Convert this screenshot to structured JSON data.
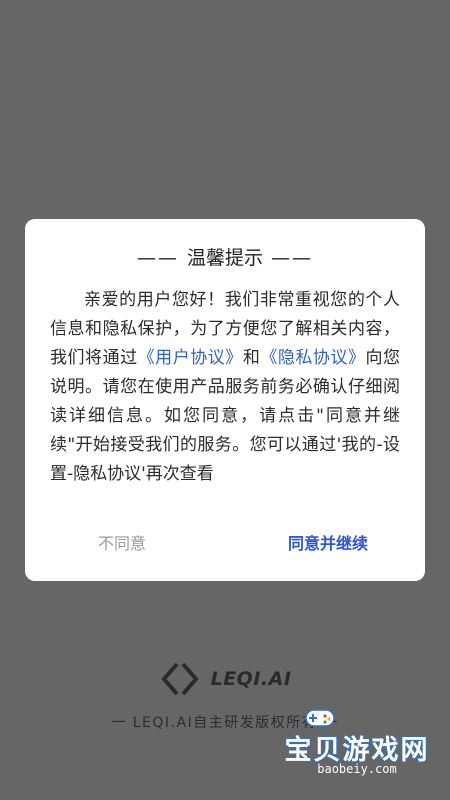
{
  "splash": {
    "brand_name": "LEQI.AI",
    "copyright": "一  LEQI.AI自主研发版权所有  一"
  },
  "watermark": {
    "title": "宝贝游戏网",
    "url": "baobeiy.com"
  },
  "dialog": {
    "title_dash_left": "—— ",
    "title": "温馨提示",
    "title_dash_right": " ——",
    "body_part1": "亲爱的用户您好！我们非常重视您的个人信息和隐私保护，为了方便您了解相关内容，我们将通过",
    "link_user_agreement": "《用户协议》",
    "body_part2": "和",
    "link_privacy_agreement": "《隐私协议》",
    "body_part3": "向您说明。请您在使用产品服务前务必确认仔细阅读详细信息。如您同意，请点击\"同意并继续\"开始接受我们的服务。您可以通过'我的-设置-隐私协议'再次查看",
    "disagree_label": "不同意",
    "agree_label": "同意并继续"
  },
  "colors": {
    "overlay": "#666666",
    "link": "#2f62c9",
    "agree": "#2f55d4",
    "disagree": "#9a9a9a"
  }
}
